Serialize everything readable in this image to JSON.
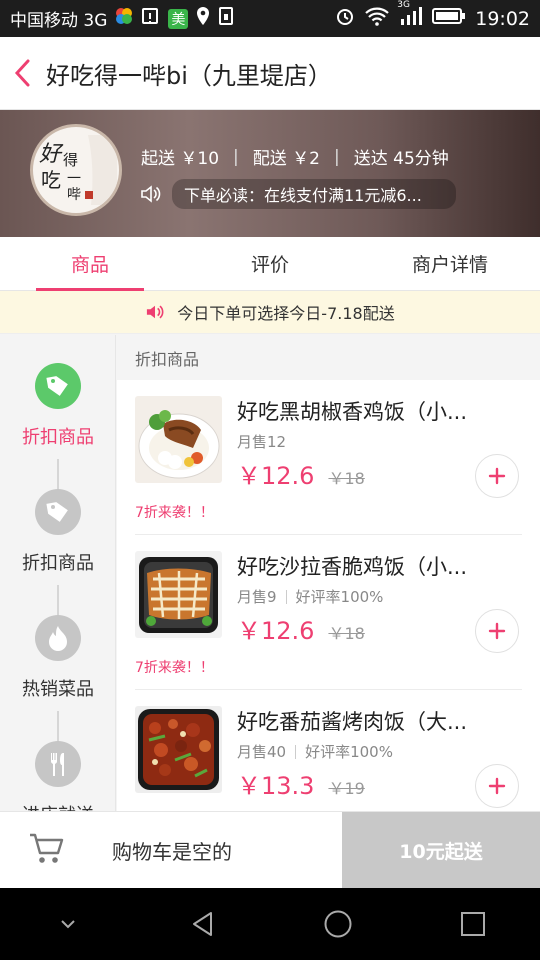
{
  "status_bar": {
    "carrier": "中国移动 3G",
    "network_label": "3G",
    "app_badge": "美",
    "time": "19:02"
  },
  "header": {
    "title": "好吃得一哔bi（九里堤店）"
  },
  "shop": {
    "logo_text": "好得吃一哔",
    "min_order": "起送 ￥10",
    "delivery_fee": "配送 ￥2",
    "delivery_time": "送达 45分钟",
    "separator": "|",
    "notice": "下单必读：在线支付满11元减6..."
  },
  "tabs": [
    {
      "label": "商品"
    },
    {
      "label": "评价"
    },
    {
      "label": "商户详情"
    }
  ],
  "promo": {
    "text": "今日下单可选择今日-7.18配送"
  },
  "sidebar": {
    "categories": [
      {
        "label": "折扣商品",
        "icon": "tag-icon",
        "active": true
      },
      {
        "label": "折扣商品",
        "icon": "tag-icon",
        "active": false
      },
      {
        "label": "热销菜品",
        "icon": "flame-icon",
        "active": false
      },
      {
        "label": "进店就送",
        "icon": "fork-knife-icon",
        "active": false
      }
    ]
  },
  "main": {
    "section_title": "折扣商品",
    "items": [
      {
        "name": "好吃黑胡椒香鸡饭（小...",
        "sales": "月售12",
        "rating": "",
        "price": "￥12.6",
        "old_price": "￥18",
        "tag": "7折来袭！！"
      },
      {
        "name": "好吃沙拉香脆鸡饭（小...",
        "sales": "月售9",
        "rating": "好评率100%",
        "price": "￥12.6",
        "old_price": "￥18",
        "tag": "7折来袭！！"
      },
      {
        "name": "好吃番茄酱烤肉饭（大...",
        "sales": "月售40",
        "rating": "好评率100%",
        "price": "￥13.3",
        "old_price": "￥19",
        "tag": ""
      }
    ]
  },
  "cart": {
    "status": "购物车是空的",
    "checkout_label": "10元起送"
  },
  "colors": {
    "accent": "#ee3f71",
    "active_tag_green": "#5cc96a",
    "inactive_icon": "#c6c6c6",
    "promo_bg": "#fdf8e1"
  }
}
